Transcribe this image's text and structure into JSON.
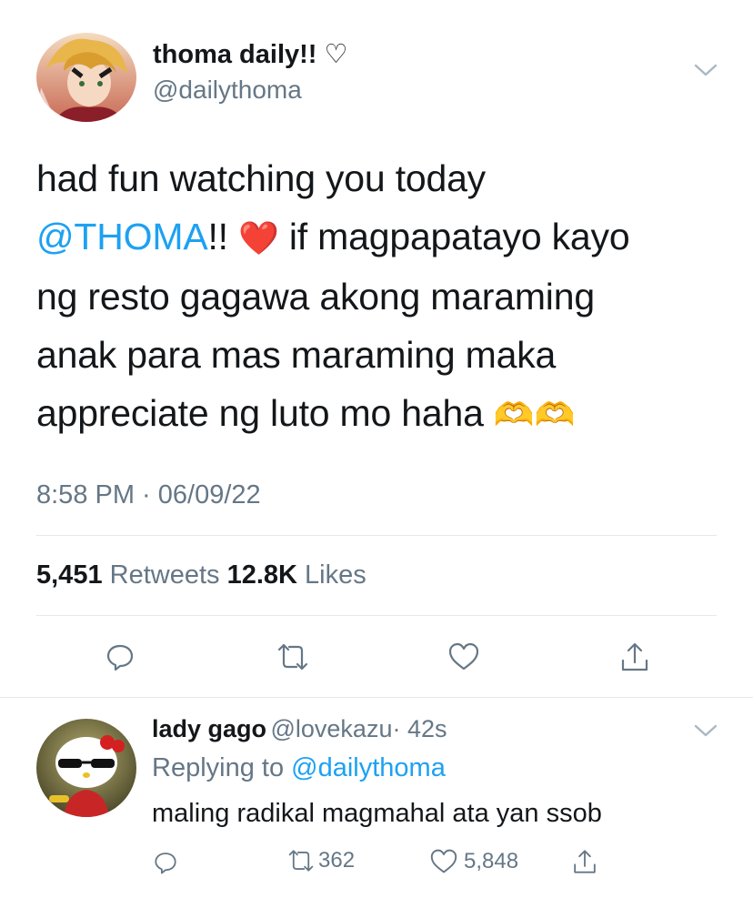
{
  "tweet": {
    "author": {
      "name": "thoma daily!!",
      "name_symbol": "♡",
      "handle": "@dailythoma"
    },
    "text": {
      "line1": "had fun watching you today",
      "mention": "@THOMA",
      "after_mention": "!!",
      "heart_emoji": "❤️",
      "line2_rest": "if magpapatayo kayo",
      "line3": "ng resto gagawa akong maraming",
      "line4": "anak para mas maraming maka",
      "line5": "appreciate ng luto mo haha",
      "hands_emoji": "🫶🫶"
    },
    "timestamp": "8:58 PM · 06/09/22",
    "stats": {
      "retweets_count": "5,451",
      "retweets_label": "Retweets",
      "likes_count": "12.8K",
      "likes_label": "Likes"
    },
    "actions": [
      "reply-icon",
      "retweet-icon",
      "like-icon",
      "share-icon"
    ]
  },
  "reply": {
    "name": "lady gago",
    "handle": "@lovekazu",
    "time": "· 42s",
    "replying_prefix": "Replying to",
    "replying_to": "@dailythoma",
    "text": "maling radikal magmahal ata yan ssob",
    "retweet_count": "362",
    "like_count": "5,848"
  },
  "colors": {
    "accent": "#1da1f2",
    "secondary_text": "#657786",
    "heart_red": "#e0245e"
  }
}
